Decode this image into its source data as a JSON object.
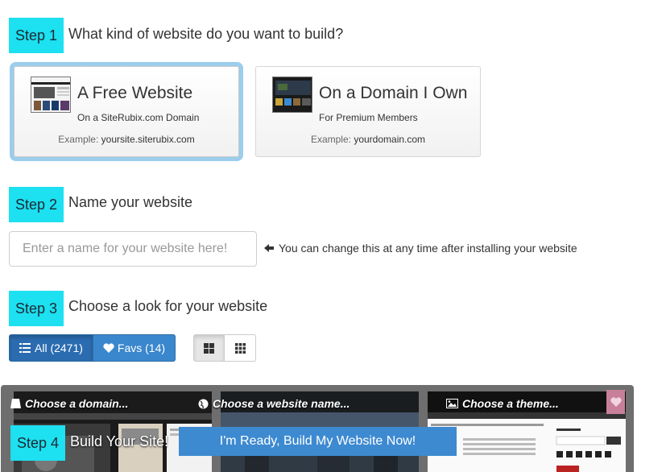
{
  "step1": {
    "badge": "Step 1",
    "title": "What kind of website do you want to build?",
    "cards": [
      {
        "title": "A Free Website",
        "subtitle": "On a SiteRubix.com Domain",
        "example_label": "Example:",
        "example_value": "yoursite.siterubix.com",
        "selected": true,
        "thumb_icon": "website-thumbnail-icon"
      },
      {
        "title": "On a Domain I Own",
        "subtitle": "For Premium Members",
        "example_label": "Example:",
        "example_value": "yourdomain.com",
        "selected": false,
        "thumb_icon": "website-thumbnail-icon"
      }
    ]
  },
  "step2": {
    "badge": "Step 2",
    "title": "Name your website",
    "input_placeholder": "Enter a name for your website here!",
    "input_value": "",
    "hint_icon": "arrow-left-icon",
    "hint": "You can change this at any time after installing your website"
  },
  "step3": {
    "badge": "Step 3",
    "title": "Choose a look for your website",
    "filters": [
      {
        "label": "All (2471)",
        "icon": "list-icon",
        "active": true
      },
      {
        "label": "Favs (14)",
        "icon": "heart-icon",
        "active": false
      }
    ],
    "view_toggles": [
      {
        "icon": "large-grid-icon",
        "active": true
      },
      {
        "icon": "small-grid-icon",
        "active": false
      }
    ]
  },
  "previews": [
    {
      "label": "Choose a domain...",
      "icon": "bookmark-icon"
    },
    {
      "label": "Choose a website name...",
      "icon": "globe-icon"
    },
    {
      "label": "Choose a theme...",
      "icon": "image-icon"
    }
  ],
  "step4": {
    "badge": "Step 4",
    "title": "Build Your Site!",
    "button": "I'm Ready, Build My Website Now!"
  },
  "colors": {
    "step_badge": "#1de0f0",
    "primary": "#3a87cd",
    "selected_glow": "#9ccdec",
    "strip": "#6e6e6e"
  }
}
